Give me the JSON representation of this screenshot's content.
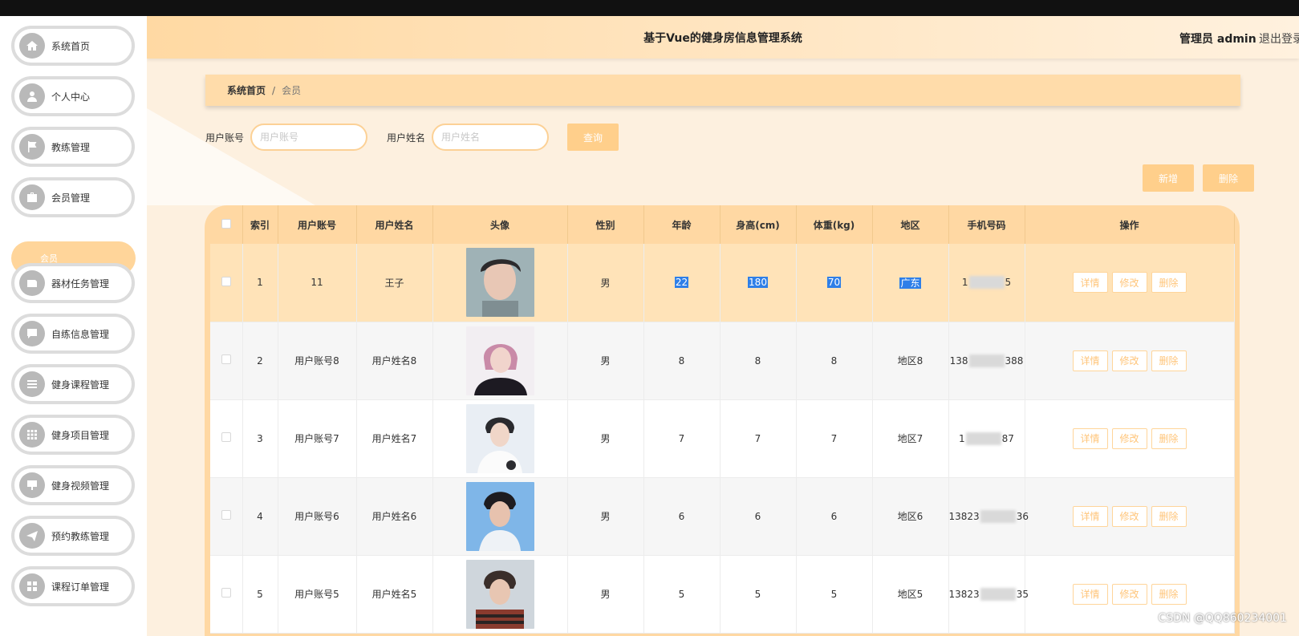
{
  "app": {
    "title": "基于Vue的健身房信息管理系统",
    "user_label": "管理员 admin",
    "logout_label": "退出登录"
  },
  "sidebar": {
    "items": [
      {
        "label": "系统首页",
        "icon": "home-icon"
      },
      {
        "label": "个人中心",
        "icon": "user-icon"
      },
      {
        "label": "教练管理",
        "icon": "flag-icon"
      },
      {
        "label": "会员管理",
        "icon": "briefcase-icon"
      },
      {
        "label": "器材任务管理",
        "icon": "wallet-icon"
      },
      {
        "label": "自练信息管理",
        "icon": "chat-icon"
      },
      {
        "label": "健身课程管理",
        "icon": "list-icon"
      },
      {
        "label": "健身项目管理",
        "icon": "grid-icon"
      },
      {
        "label": "健身视频管理",
        "icon": "chalkboard-icon"
      },
      {
        "label": "预约教练管理",
        "icon": "send-icon"
      },
      {
        "label": "课程订单管理",
        "icon": "apps-icon"
      }
    ],
    "active_sub": "会员"
  },
  "breadcrumb": {
    "home": "系统首页",
    "separator": "/",
    "current": "会员"
  },
  "search": {
    "account_label": "用户账号",
    "account_placeholder": "用户账号",
    "name_label": "用户姓名",
    "name_placeholder": "用户姓名",
    "query_button": "查询"
  },
  "actions": {
    "add_button": "新增",
    "delete_button": "删除"
  },
  "table": {
    "headers": [
      "索引",
      "用户账号",
      "用户姓名",
      "头像",
      "性别",
      "年龄",
      "身高(cm)",
      "体重(kg)",
      "地区",
      "手机号码",
      "操作"
    ],
    "rows": [
      {
        "index": "1",
        "account": "11",
        "name": "王子",
        "gender": "男",
        "age": "22",
        "height": "180",
        "weight": "70",
        "region": "广东",
        "phone_start": "1",
        "phone_end": "5"
      },
      {
        "index": "2",
        "account": "用户账号8",
        "name": "用户姓名8",
        "gender": "男",
        "age": "8",
        "height": "8",
        "weight": "8",
        "region": "地区8",
        "phone_start": "138",
        "phone_end": "388"
      },
      {
        "index": "3",
        "account": "用户账号7",
        "name": "用户姓名7",
        "gender": "男",
        "age": "7",
        "height": "7",
        "weight": "7",
        "region": "地区7",
        "phone_start": "1",
        "phone_end": "87"
      },
      {
        "index": "4",
        "account": "用户账号6",
        "name": "用户姓名6",
        "gender": "男",
        "age": "6",
        "height": "6",
        "weight": "6",
        "region": "地区6",
        "phone_start": "13823",
        "phone_end": "36"
      },
      {
        "index": "5",
        "account": "用户账号5",
        "name": "用户姓名5",
        "gender": "男",
        "age": "5",
        "height": "5",
        "weight": "5",
        "region": "地区5",
        "phone_start": "13823",
        "phone_end": "35"
      }
    ],
    "op_labels": {
      "detail": "详情",
      "edit": "修改",
      "delete": "删除"
    }
  },
  "watermark": "CSDN @QQ860234001",
  "colors": {
    "accent": "#ffcf8b",
    "header_bg": "#ffd9a3",
    "selection": "#2e7fe8"
  }
}
